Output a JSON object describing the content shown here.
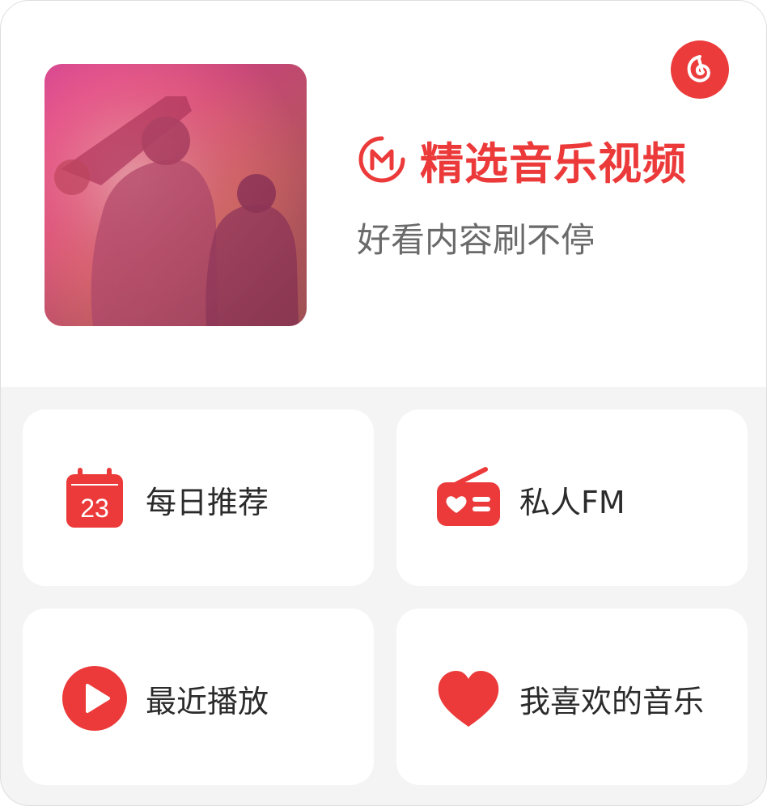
{
  "header": {
    "title": "精选音乐视频",
    "subtitle": "好看内容刷不停",
    "cover_image": "concert-performers-photo",
    "brand_logo": "netease-cloud-music-logo",
    "title_icon": "mv-icon"
  },
  "tiles": [
    {
      "label": "每日推荐",
      "icon": "calendar-icon",
      "icon_text": "23"
    },
    {
      "label": "私人FM",
      "icon": "radio-heart-icon"
    },
    {
      "label": "最近播放",
      "icon": "play-circle-icon"
    },
    {
      "label": "我喜欢的音乐",
      "icon": "heart-icon"
    }
  ],
  "colors": {
    "accent": "#ec3a3a",
    "tile_background": "#ffffff",
    "page_background": "#f4f4f4",
    "subtitle": "#6a6a6a",
    "label": "#2b2b2b"
  }
}
